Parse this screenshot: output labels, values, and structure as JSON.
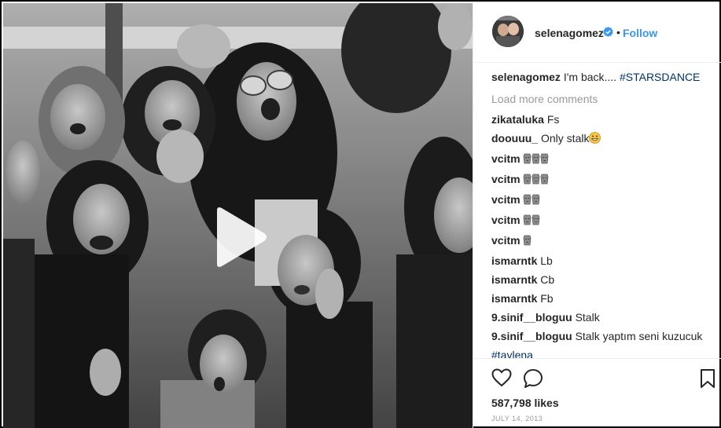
{
  "post": {
    "username": "selenagomez",
    "follow_label": "Follow",
    "separator": "•",
    "load_more": "Load more comments",
    "likes": "587,798 likes",
    "date": "JULY 14, 2013"
  },
  "caption": {
    "user": "selenagomez",
    "text": "I'm back....",
    "hashtag": "#STARSDANCE"
  },
  "comments": [
    {
      "user": "zikataluka",
      "text": "Fs",
      "emoji": "",
      "emoji_count": 0
    },
    {
      "user": "doouuu_",
      "text": "Only stalk",
      "emoji": "grinning-emoji",
      "emoji_count": 1
    },
    {
      "user": "vcitm",
      "text": "",
      "emoji": "moai-emoji",
      "emoji_count": 3
    },
    {
      "user": "vcitm",
      "text": "",
      "emoji": "moai-emoji",
      "emoji_count": 3
    },
    {
      "user": "vcitm",
      "text": "",
      "emoji": "moai-emoji",
      "emoji_count": 2
    },
    {
      "user": "vcitm",
      "text": "",
      "emoji": "moai-emoji",
      "emoji_count": 2
    },
    {
      "user": "vcitm",
      "text": "",
      "emoji": "moai-emoji",
      "emoji_count": 1
    },
    {
      "user": "ismarntk",
      "text": "Lb",
      "emoji": "",
      "emoji_count": 0
    },
    {
      "user": "ismarntk",
      "text": "Cb",
      "emoji": "",
      "emoji_count": 0
    },
    {
      "user": "ismarntk",
      "text": "Fb",
      "emoji": "",
      "emoji_count": 0
    },
    {
      "user": "9.sinif__bloguu",
      "text": "Stalk",
      "emoji": "",
      "emoji_count": 0
    },
    {
      "user": "9.sinif__bloguu",
      "text": "Stalk yaptım seni kuzucuk",
      "emoji": "",
      "emoji_count": 0,
      "hashtag": "#taylena"
    }
  ],
  "icons": {
    "heart": "heart-icon",
    "comment": "comment-icon",
    "bookmark": "bookmark-icon",
    "play": "play-icon",
    "verified": "verified-badge-icon"
  },
  "colors": {
    "link": "#3897f0",
    "hashtag": "#003569",
    "muted": "#999999",
    "text": "#262626"
  }
}
